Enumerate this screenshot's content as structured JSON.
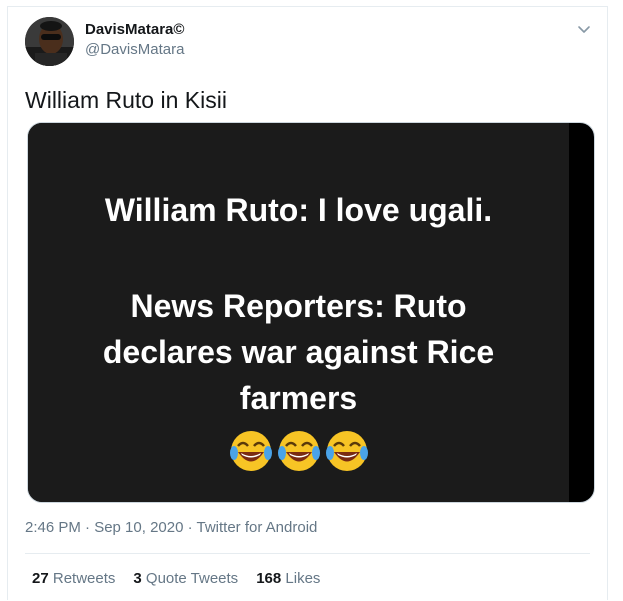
{
  "tweet": {
    "display_name": "DavisMatara©",
    "handle": "@DavisMatara",
    "text": "William Ruto in Kisii",
    "image_text": {
      "line1": "William Ruto: I love ugali.",
      "line2": "News Reporters: Ruto",
      "line3": "declares war against Rice",
      "line4": "farmers"
    },
    "emojis": [
      "face-with-tears-of-joy-icon",
      "face-with-tears-of-joy-icon",
      "face-with-tears-of-joy-icon"
    ],
    "timestamp": "2:46 PM · Sep 10, 2020 · Twitter for Android",
    "stats": {
      "retweets_count": "27",
      "retweets_label": "Retweets",
      "quotes_count": "3",
      "quotes_label": "Quote Tweets",
      "likes_count": "168",
      "likes_label": "Likes"
    }
  },
  "colors": {
    "text_primary": "#14171a",
    "text_secondary": "#657786",
    "divider": "#e6ecf0",
    "media_background": "#1b1b1b"
  }
}
